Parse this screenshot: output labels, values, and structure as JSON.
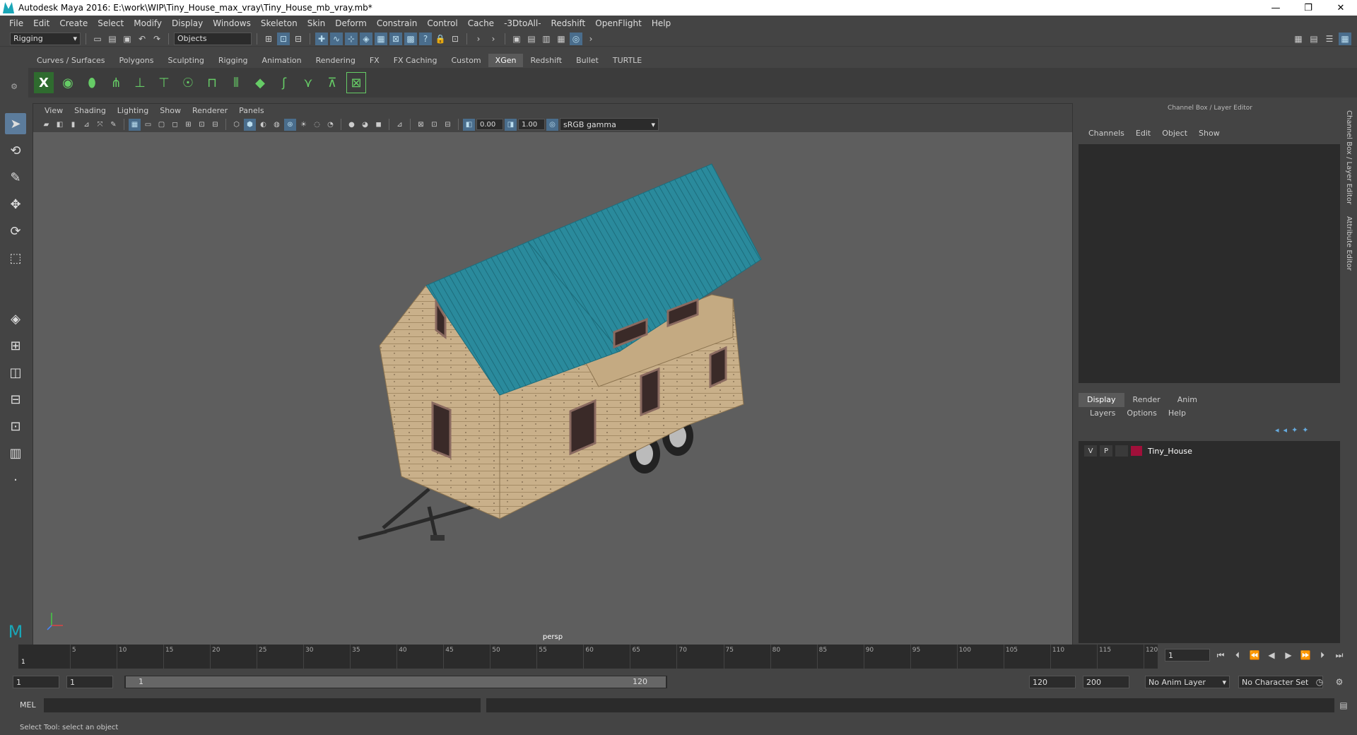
{
  "window": {
    "title": "Autodesk Maya 2016: E:\\work\\WIP\\Tiny_House_max_vray\\Tiny_House_mb_vray.mb*"
  },
  "menubar": [
    "File",
    "Edit",
    "Create",
    "Select",
    "Modify",
    "Display",
    "Windows",
    "Skeleton",
    "Skin",
    "Deform",
    "Constrain",
    "Control",
    "Cache",
    "-3DtoAll-",
    "Redshift",
    "OpenFlight",
    "Help"
  ],
  "status": {
    "mode": "Rigging",
    "selection": "Objects"
  },
  "shelf": {
    "tabs": [
      "Curves / Surfaces",
      "Polygons",
      "Sculpting",
      "Rigging",
      "Animation",
      "Rendering",
      "FX",
      "FX Caching",
      "Custom",
      "XGen",
      "Redshift",
      "Bullet",
      "TURTLE"
    ],
    "active_tab": "XGen"
  },
  "viewport": {
    "menu": [
      "View",
      "Shading",
      "Lighting",
      "Show",
      "Renderer",
      "Panels"
    ],
    "exposure": "0.00",
    "gamma": "1.00",
    "color_space": "sRGB gamma",
    "camera": "persp"
  },
  "channel_box": {
    "title": "Channel Box / Layer Editor",
    "menu": [
      "Channels",
      "Edit",
      "Object",
      "Show"
    ]
  },
  "layer_editor": {
    "tabs": [
      "Display",
      "Render",
      "Anim"
    ],
    "active_tab": "Display",
    "menu": [
      "Layers",
      "Options",
      "Help"
    ],
    "layers": [
      {
        "v": "V",
        "p": "P",
        "name": "Tiny_House",
        "color": "#a0103a"
      }
    ]
  },
  "side_tabs": [
    "Channel Box / Layer Editor",
    "Attribute Editor"
  ],
  "timeline": {
    "ticks": [
      "5",
      "10",
      "15",
      "20",
      "25",
      "30",
      "35",
      "40",
      "45",
      "50",
      "55",
      "60",
      "65",
      "70",
      "75",
      "80",
      "85",
      "90",
      "95",
      "100",
      "105",
      "110",
      "115",
      "120"
    ],
    "start_label": "1",
    "current_frame": "1"
  },
  "range": {
    "start": "1",
    "playback_start": "1",
    "slider_start": "1",
    "slider_end": "120",
    "playback_end": "120",
    "end": "200",
    "anim_layer": "No Anim Layer",
    "character_set": "No Character Set"
  },
  "command_line": {
    "label": "MEL"
  },
  "help_line": "Select Tool: select an object"
}
